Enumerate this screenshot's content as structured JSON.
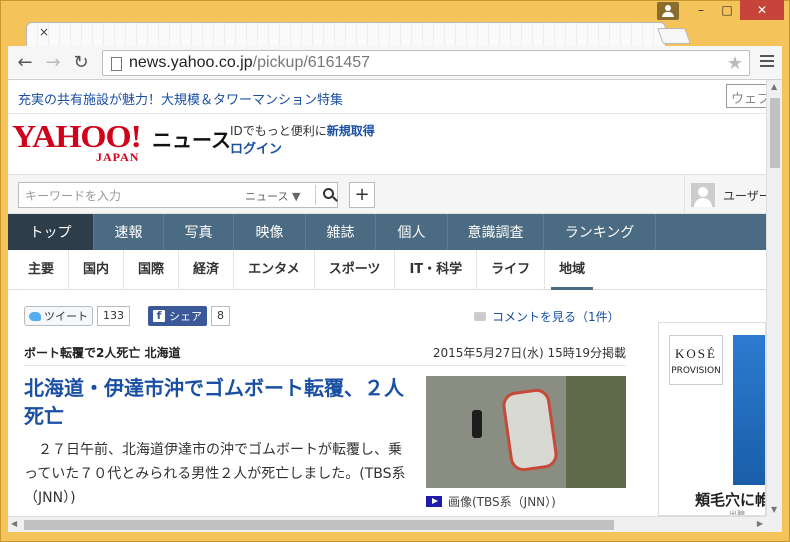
{
  "browser": {
    "url_host": "news.yahoo.co.jp",
    "url_path": "/pickup/6161457",
    "tab_close": "×",
    "window_buttons": {
      "minimize": "–",
      "maximize": "□",
      "close": "✕"
    }
  },
  "promo": {
    "link": "充実の共有施設が魅力！大規模＆タワーマンション特集",
    "side_input_placeholder": "ウェブ"
  },
  "header": {
    "logo_text": "YAHOO!",
    "logo_sub": "JAPAN",
    "section_title": "ニュース",
    "id_prompt": "IDでもっと便利に",
    "id_signup": "新規取得",
    "login": "ログイン"
  },
  "search": {
    "placeholder": "キーワードを入力",
    "scope": "ニュース ▼",
    "plus": "+",
    "user_label": "ユーザー名"
  },
  "mainnav": {
    "items": [
      {
        "label": "トップ"
      },
      {
        "label": "速報"
      },
      {
        "label": "写真"
      },
      {
        "label": "映像"
      },
      {
        "label": "雑誌"
      },
      {
        "label": "個人"
      },
      {
        "label": "意識調査"
      },
      {
        "label": "ランキング"
      }
    ]
  },
  "subnav": {
    "items": [
      {
        "label": "主要"
      },
      {
        "label": "国内"
      },
      {
        "label": "国際"
      },
      {
        "label": "経済"
      },
      {
        "label": "エンタメ"
      },
      {
        "label": "スポーツ"
      },
      {
        "label": "IT・科学"
      },
      {
        "label": "ライフ"
      },
      {
        "label": "地域"
      }
    ]
  },
  "share": {
    "tweet_label": "ツイート",
    "tweet_count": "133",
    "fb_label": "シェア",
    "fb_count": "8",
    "comment_link": "コメントを見る（1件）"
  },
  "article": {
    "topic": "ボート転覆で2人死亡 北海道",
    "date": "2015年5月27日(水) 15時19分掲載",
    "headline": "北海道・伊達市沖でゴムボート転覆、２人死亡",
    "lead": "　２７日午前、北海道伊達市の沖でゴムボートが転覆し、乗っていた７０代とみられる男性２人が死亡しました。(TBS系（JNN）)",
    "photo_caption": "画像(TBS系（JNN）)"
  },
  "ad": {
    "brand": "KOSÉ",
    "brand_sub": "PROVISION",
    "tagline": "頬毛穴に帷",
    "small": "出腺"
  },
  "colors": {
    "nav_bg": "#4a6b82",
    "nav_active": "#2d3d4a",
    "link": "#1a4fa3",
    "logo_red": "#d0021b",
    "frame": "#f4c45a"
  }
}
